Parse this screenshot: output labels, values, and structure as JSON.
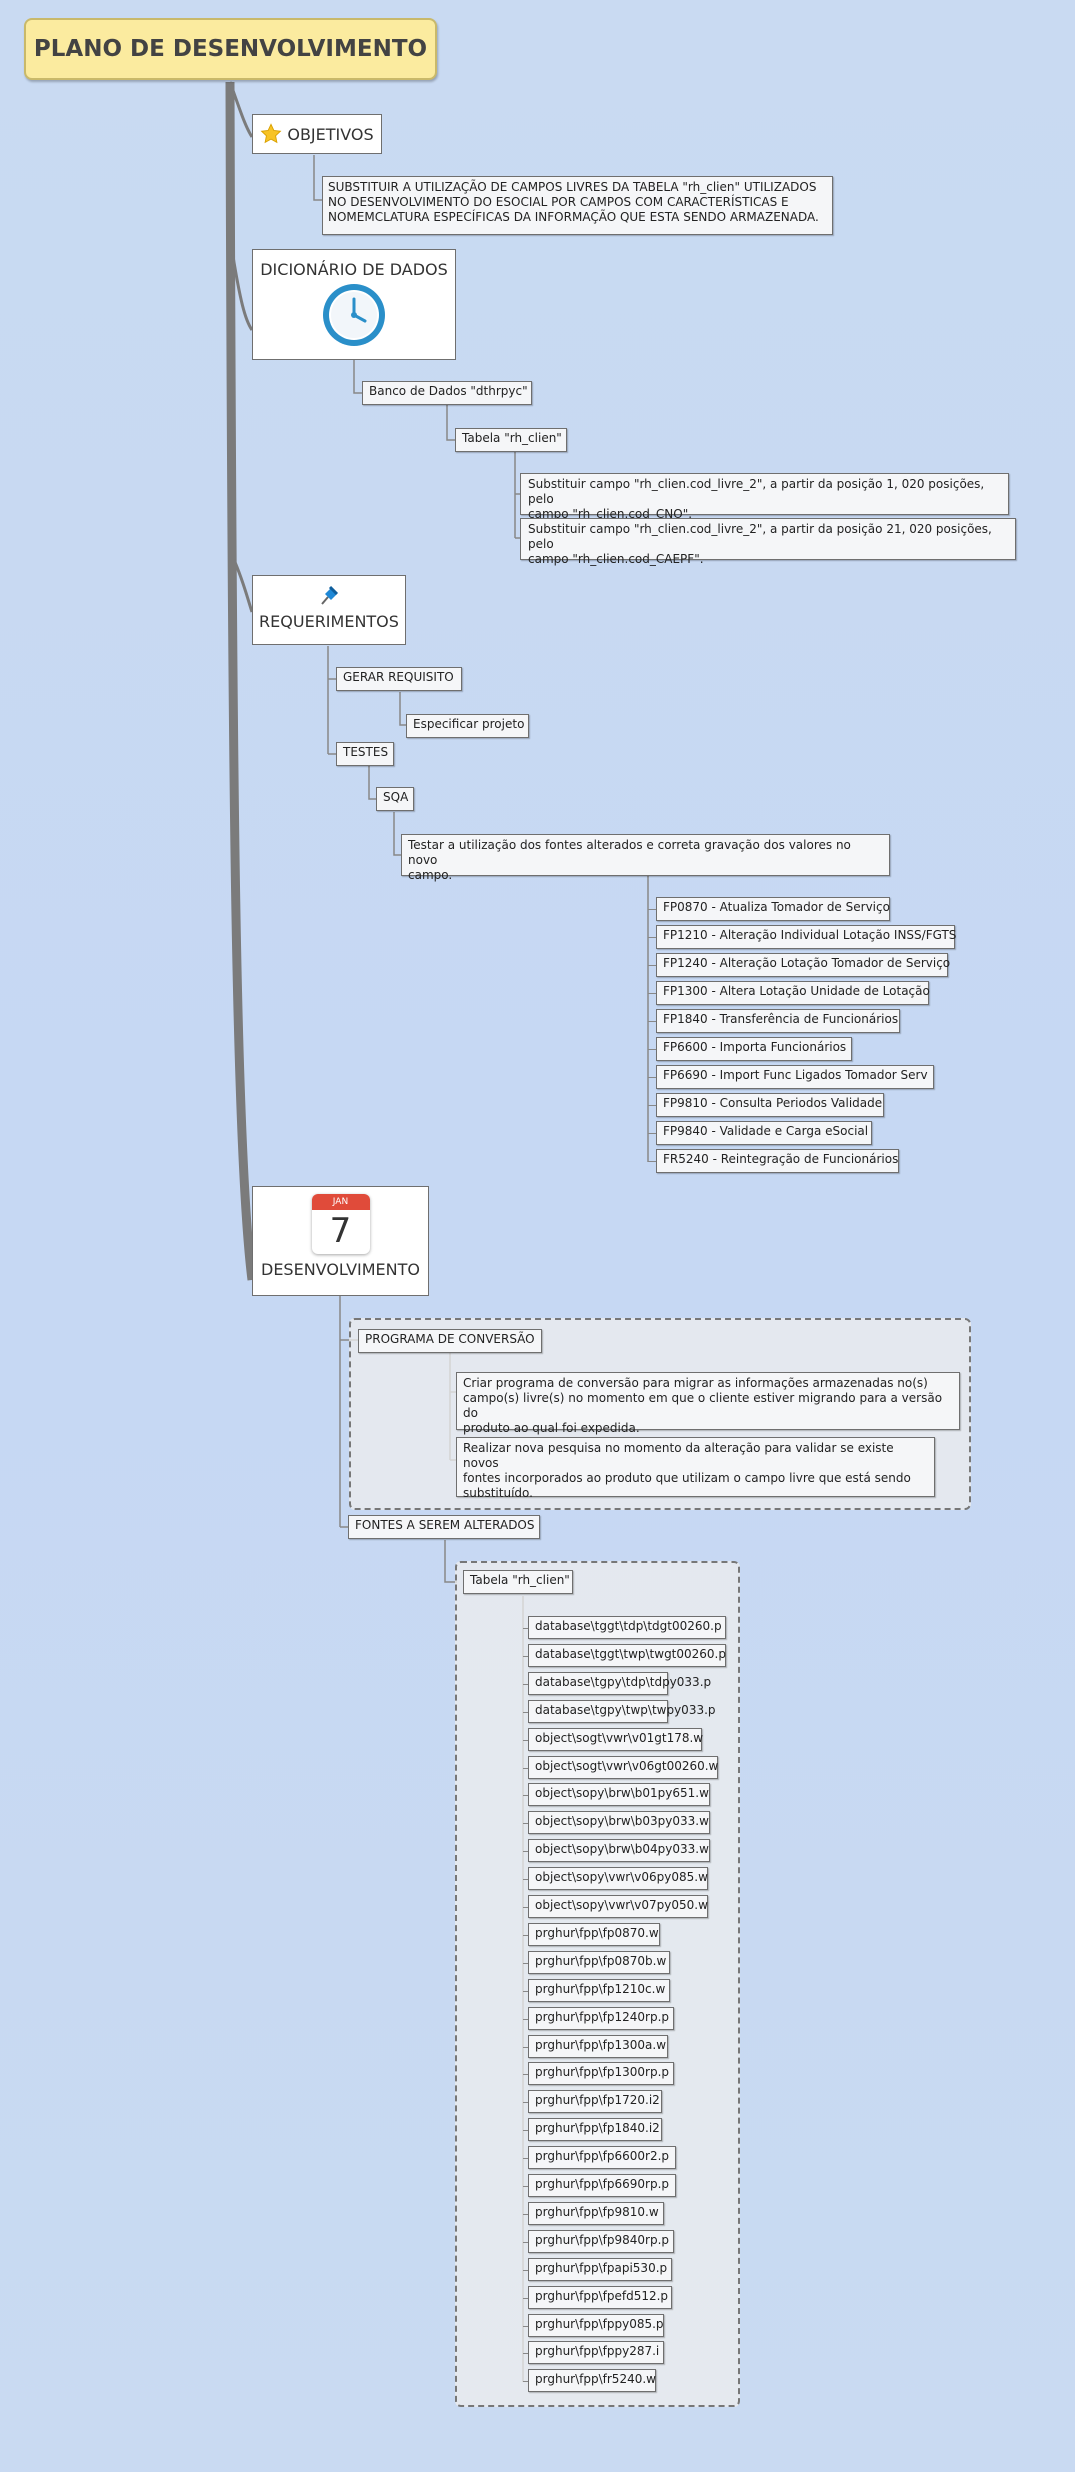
{
  "root": {
    "title": "PLANO DE DESENVOLVIMENTO"
  },
  "objetivos": {
    "title": "OBJETIVOS",
    "icon": "star-icon",
    "text_lines": [
      "SUBSTITUIR A UTILIZAÇÃO DE CAMPOS LIVRES DA TABELA \"rh_clien\" UTILIZADOS",
      "NO DESENVOLVIMENTO DO ESOCIAL POR CAMPOS COM CARACTERÍSTICAS E",
      "NOMEMCLATURA ESPECÍFICAS DA INFORMAÇÃO QUE ESTA SENDO ARMAZENADA."
    ]
  },
  "dicionario": {
    "title": "DICIONÁRIO DE DADOS",
    "icon": "clock-icon",
    "banco": "Banco de Dados \"dthrpyc\"",
    "tabela": "Tabela \"rh_clien\"",
    "subst1": [
      "Substituir campo \"rh_clien.cod_livre_2\", a partir da posição 1, 020 posições,  pelo",
      "campo \"rh_clien.cod_CNO\"."
    ],
    "subst2": [
      "Substituir campo \"rh_clien.cod_livre_2\", a partir da posição 21, 020 posições,  pelo",
      "campo \"rh_clien.cod_CAEPF\"."
    ]
  },
  "requerimentos": {
    "title": "REQUERIMENTOS",
    "icon": "pushpin-icon",
    "gerar": "GERAR REQUISITO",
    "especificar": "Especificar projeto",
    "testes": "TESTES",
    "sqa": "SQA",
    "testar": [
      " Testar a utilização dos fontes alterados e correta gravação dos valores no novo",
      "campo."
    ],
    "programs": [
      "FP0870 - Atualiza Tomador de Serviço",
      "FP1210 - Alteração Individual Lotação INSS/FGTS",
      "FP1240 - Alteração Lotação Tomador de Serviço",
      "FP1300 - Altera Lotação Unidade de Lotação",
      "FP1840 - Transferência de Funcionários",
      "FP6600 - Importa Funcionários",
      "FP6690 - Import Func Ligados Tomador Serv",
      "FP9810 - Consulta Periodos Validade",
      "FP9840 - Validade e Carga eSocial",
      "FR5240 - Reintegração de Funcionários"
    ]
  },
  "desenvolvimento": {
    "title": "DESENVOLVIMENTO",
    "icon": "calendar-icon",
    "calendar_month": "JAN",
    "calendar_day": "7",
    "programa": "PROGRAMA DE CONVERSÃO",
    "criar": [
      " Criar programa de conversão para migrar as informações armazenadas no(s)",
      "campo(s) livre(s) no momento em que o cliente estiver migrando para a versão do",
      "produto ao qual foi expedida."
    ],
    "realizar": [
      "Realizar nova pesquisa no momento da alteração para validar se existe novos",
      "fontes incorporados ao produto que utilizam o campo livre que está sendo",
      "substituído."
    ],
    "fontes": "FONTES A SEREM ALTERADOS",
    "tabela": "Tabela \"rh_clien\"",
    "files": [
      "database\\tggt\\tdp\\tdgt00260.p",
      "database\\tggt\\twp\\twgt00260.p",
      "database\\tgpy\\tdp\\tdpy033.p",
      "database\\tgpy\\twp\\twpy033.p",
      "object\\sogt\\vwr\\v01gt178.w",
      "object\\sogt\\vwr\\v06gt00260.w",
      "object\\sopy\\brw\\b01py651.w",
      "object\\sopy\\brw\\b03py033.w",
      "object\\sopy\\brw\\b04py033.w",
      "object\\sopy\\vwr\\v06py085.w",
      "object\\sopy\\vwr\\v07py050.w",
      "prghur\\fpp\\fp0870.w",
      "prghur\\fpp\\fp0870b.w",
      "prghur\\fpp\\fp1210c.w",
      "prghur\\fpp\\fp1240rp.p",
      "prghur\\fpp\\fp1300a.w",
      "prghur\\fpp\\fp1300rp.p",
      "prghur\\fpp\\fp1720.i2",
      "prghur\\fpp\\fp1840.i2",
      "prghur\\fpp\\fp6600r2.p",
      "prghur\\fpp\\fp6690rp.p",
      "prghur\\fpp\\fp9810.w",
      "prghur\\fpp\\fp9840rp.p",
      "prghur\\fpp\\fpapi530.p",
      "prghur\\fpp\\fpefd512.p",
      "prghur\\fpp\\fppy085.p",
      "prghur\\fpp\\fppy287.i",
      "prghur\\fpp\\fr5240.w"
    ]
  },
  "colors": {
    "background": "#c9daf2",
    "root": "#fbeb9f",
    "connector": "#777777"
  }
}
